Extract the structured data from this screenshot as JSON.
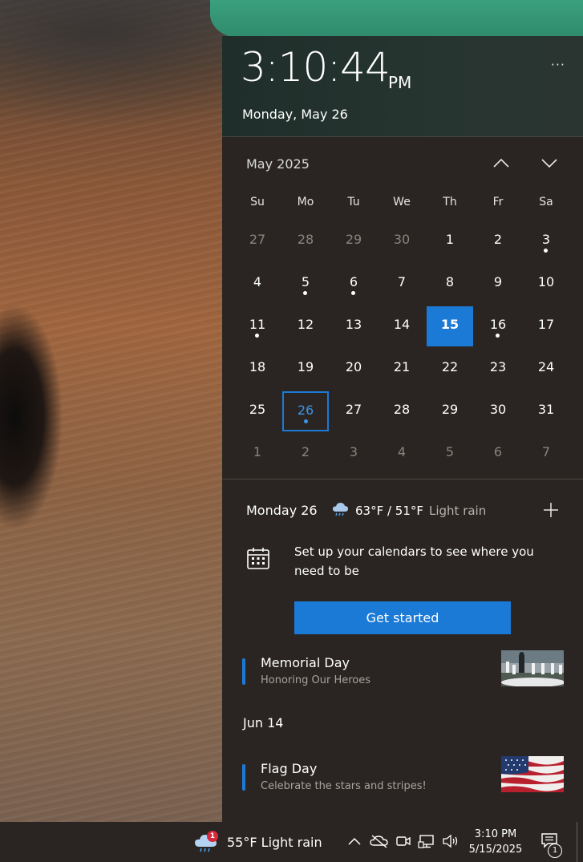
{
  "clock": {
    "time": "3:10:44",
    "ampm": "PM",
    "date": "Monday, May 26",
    "more_label": "···"
  },
  "calendar": {
    "month_label": "May 2025",
    "prev_icon": "chevron-up-icon",
    "next_icon": "chevron-down-icon",
    "day_headers": [
      "Su",
      "Mo",
      "Tu",
      "We",
      "Th",
      "Fr",
      "Sa"
    ],
    "weeks": [
      [
        {
          "d": "27",
          "m": true
        },
        {
          "d": "28",
          "m": true
        },
        {
          "d": "29",
          "m": true
        },
        {
          "d": "30",
          "m": true
        },
        {
          "d": "1"
        },
        {
          "d": "2"
        },
        {
          "d": "3",
          "dot": true
        }
      ],
      [
        {
          "d": "4"
        },
        {
          "d": "5",
          "dot": true
        },
        {
          "d": "6",
          "dot": true
        },
        {
          "d": "7"
        },
        {
          "d": "8"
        },
        {
          "d": "9"
        },
        {
          "d": "10"
        }
      ],
      [
        {
          "d": "11",
          "dot": true
        },
        {
          "d": "12"
        },
        {
          "d": "13"
        },
        {
          "d": "14"
        },
        {
          "d": "15",
          "today": true
        },
        {
          "d": "16",
          "dot": true
        },
        {
          "d": "17"
        }
      ],
      [
        {
          "d": "18"
        },
        {
          "d": "19"
        },
        {
          "d": "20"
        },
        {
          "d": "21"
        },
        {
          "d": "22"
        },
        {
          "d": "23"
        },
        {
          "d": "24"
        }
      ],
      [
        {
          "d": "25"
        },
        {
          "d": "26",
          "selected": true,
          "dot": true
        },
        {
          "d": "27"
        },
        {
          "d": "28"
        },
        {
          "d": "29"
        },
        {
          "d": "30"
        },
        {
          "d": "31"
        }
      ],
      [
        {
          "d": "1",
          "m": true
        },
        {
          "d": "2",
          "m": true
        },
        {
          "d": "3",
          "m": true
        },
        {
          "d": "4",
          "m": true
        },
        {
          "d": "5",
          "m": true
        },
        {
          "d": "6",
          "m": true
        },
        {
          "d": "7",
          "m": true
        }
      ]
    ],
    "accent_color": "#1b7ad6"
  },
  "agenda": {
    "date": "Monday 26",
    "weather_icon": "rain-cloud-icon",
    "temps": "63°F / 51°F",
    "condition": "Light rain",
    "add_icon": "plus-icon",
    "setup_text": "Set up your calendars to see where you need to be",
    "get_started": "Get started",
    "events": [
      {
        "title": "Memorial Day",
        "subtitle": "Honoring Our Heroes",
        "thumb": "memorial-thumbnail"
      },
      {
        "title": "Flag Day",
        "subtitle": "Celebrate the stars and stripes!",
        "thumb": "flag-thumbnail"
      }
    ],
    "section_date": "Jun 14"
  },
  "taskbar": {
    "weather_badge": "1",
    "weather_text": "55°F  Light rain",
    "time": "3:10 PM",
    "date": "5/15/2025",
    "notification_count": "1",
    "icons": [
      "chevron-up-icon",
      "onedrive-offline-icon",
      "meet-now-icon",
      "network-icon",
      "volume-icon",
      "notification-icon"
    ]
  }
}
